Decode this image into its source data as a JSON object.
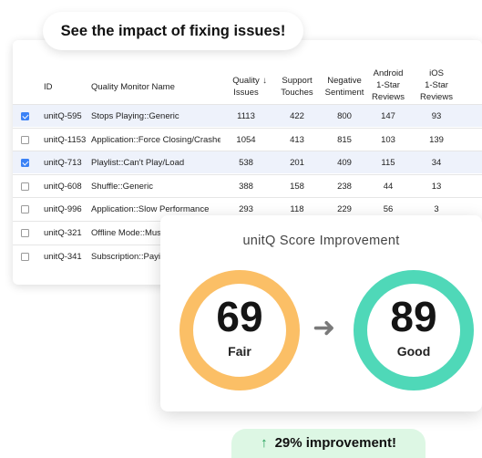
{
  "header": {
    "title": "See the impact of fixing issues!"
  },
  "table": {
    "columns": {
      "id": "ID",
      "name": "Quality Monitor Name",
      "quality": [
        "Quality",
        "Issues"
      ],
      "support": [
        "Support",
        "Touches"
      ],
      "negative": [
        "Negative",
        "Sentiment"
      ],
      "android": [
        "Android",
        "1-Star",
        "Reviews"
      ],
      "ios": [
        "iOS",
        "1-Star",
        "Reviews"
      ],
      "sort_icon": "arrow-down-icon"
    },
    "rows": [
      {
        "checked": true,
        "id": "unitQ-595",
        "name": "Stops Playing::Generic",
        "quality": "1113",
        "support": "422",
        "negative": "800",
        "android": "147",
        "ios": "93"
      },
      {
        "checked": false,
        "id": "unitQ-1153",
        "name": "Application::Force Closing/Crashes",
        "quality": "1054",
        "support": "413",
        "negative": "815",
        "android": "103",
        "ios": "139"
      },
      {
        "checked": true,
        "id": "unitQ-713",
        "name": "Playlist::Can't Play/Load",
        "quality": "538",
        "support": "201",
        "negative": "409",
        "android": "115",
        "ios": "34"
      },
      {
        "checked": false,
        "id": "unitQ-608",
        "name": "Shuffle::Generic",
        "quality": "388",
        "support": "158",
        "negative": "238",
        "android": "44",
        "ios": "13"
      },
      {
        "checked": false,
        "id": "unitQ-996",
        "name": "Application::Slow Performance",
        "quality": "293",
        "support": "118",
        "negative": "229",
        "android": "56",
        "ios": "3"
      },
      {
        "checked": false,
        "id": "unitQ-321",
        "name": "Offline Mode::Music N",
        "quality": "",
        "support": "",
        "negative": "",
        "android": "",
        "ios": ""
      },
      {
        "checked": false,
        "id": "unitQ-341",
        "name": "Subscription::Paying (",
        "quality": "",
        "support": "",
        "negative": "",
        "android": "",
        "ios": ""
      }
    ]
  },
  "score": {
    "title": "unitQ Score Improvement",
    "before": {
      "value": "69",
      "label": "Fair",
      "color": "#fbbf66"
    },
    "after": {
      "value": "89",
      "label": "Good",
      "color": "#4fd8b8"
    },
    "arrow_icon": "arrow-right-icon"
  },
  "improvement": {
    "icon": "arrow-up-icon",
    "text": "29% improvement!",
    "color": "#1f9d55"
  }
}
